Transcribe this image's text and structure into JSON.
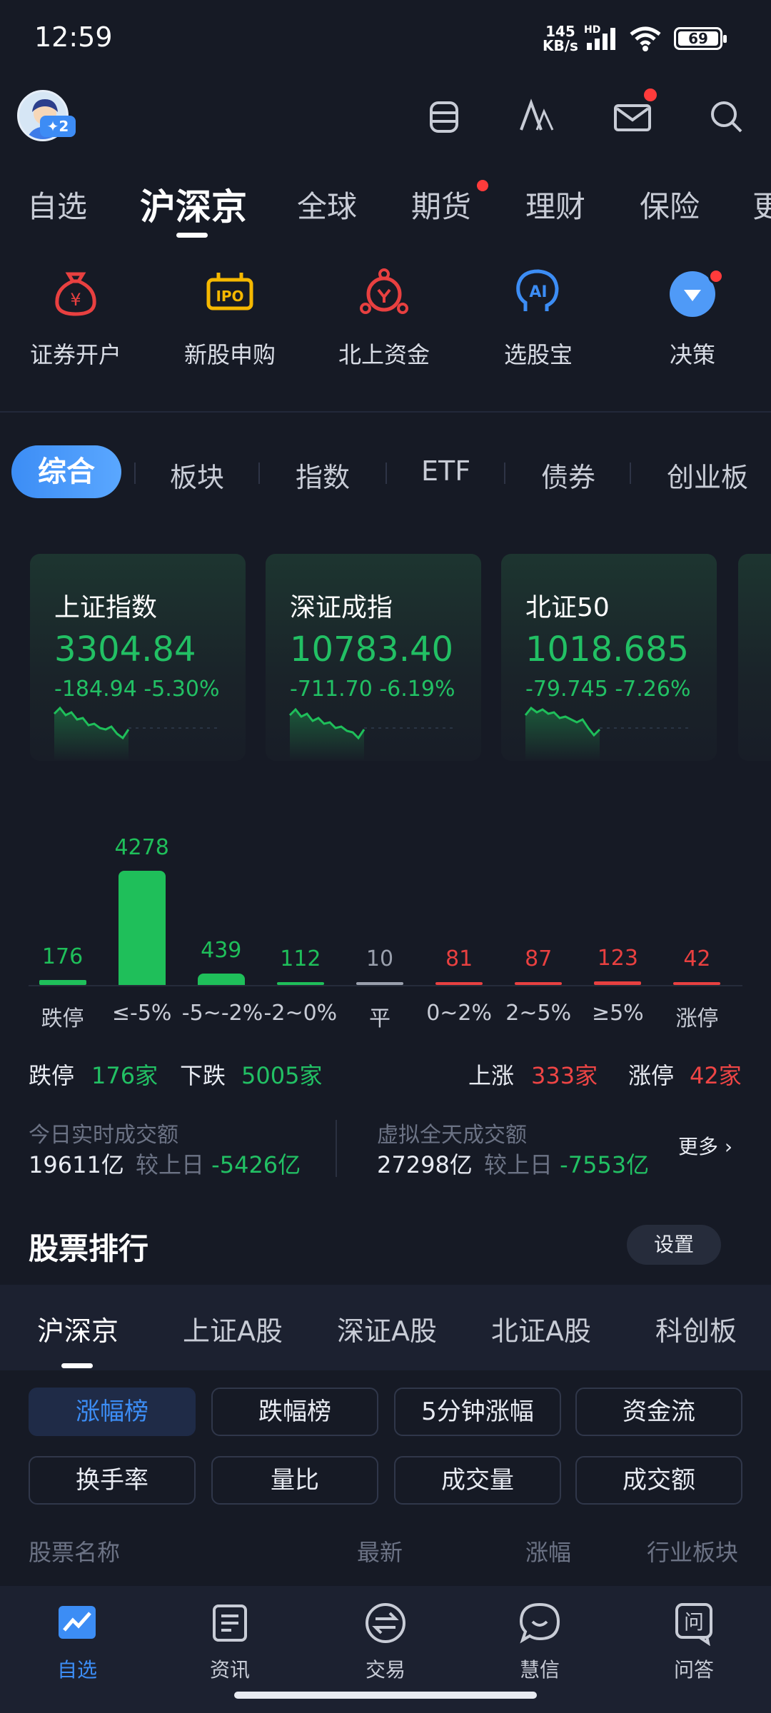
{
  "status_bar": {
    "time": "12:59",
    "net_speed_value": "145",
    "net_speed_unit": "KB/s",
    "net_type": "HD",
    "battery": "69"
  },
  "main_tabs": [
    "自选",
    "沪深京",
    "全球",
    "期货",
    "理财",
    "保险",
    "更"
  ],
  "main_tab_active": "沪深京",
  "quick_entries": [
    "证券开户",
    "新股申购",
    "北上资金",
    "选股宝",
    "决策"
  ],
  "sub_tabs": [
    "综合",
    "板块",
    "指数",
    "ETF",
    "债券",
    "创业板"
  ],
  "index_cards": [
    {
      "name": "上证指数",
      "value": "3304.84",
      "change": "-184.94",
      "pct": "-5.30%"
    },
    {
      "name": "深证成指",
      "value": "10783.40",
      "change": "-711.70",
      "pct": "-6.19%"
    },
    {
      "name": "北证50",
      "value": "1018.685",
      "change": "-79.745",
      "pct": "-7.26%"
    }
  ],
  "chart_data": {
    "type": "bar",
    "categories": [
      "跌停",
      "≤-5%",
      "-5~-2%",
      "-2~0%",
      "平",
      "0~2%",
      "2~5%",
      "≥5%",
      "涨停"
    ],
    "values": [
      176,
      4278,
      439,
      112,
      10,
      81,
      87,
      123,
      42
    ],
    "colors": [
      "#1fbf5a",
      "#1fbf5a",
      "#1fbf5a",
      "#1fbf5a",
      "#9aa0ad",
      "#e84040",
      "#e84040",
      "#e84040",
      "#e84040"
    ]
  },
  "stats": {
    "limit_down_label": "跌停",
    "limit_down_value": "176家",
    "down_label": "下跌",
    "down_value": "5005家",
    "up_label": "上涨",
    "up_value": "333家",
    "limit_up_label": "涨停",
    "limit_up_value": "42家"
  },
  "turnover": {
    "today_label": "今日实时成交额",
    "today_value": "19611亿",
    "compare_label": "较上日",
    "today_diff": "-5426亿",
    "virtual_label": "虚拟全天成交额",
    "virtual_value": "27298亿",
    "virtual_diff": "-7553亿",
    "more": "更多"
  },
  "ranking": {
    "title": "股票排行",
    "settings": "设置",
    "markets": [
      "沪深京",
      "上证A股",
      "深证A股",
      "北证A股",
      "科创板"
    ],
    "chips": [
      "涨幅榜",
      "跌幅榜",
      "5分钟涨幅",
      "资金流",
      "换手率",
      "量比",
      "成交量",
      "成交额"
    ],
    "columns": [
      "股票名称",
      "最新",
      "涨幅",
      "行业板块"
    ]
  },
  "bottom_nav": [
    "自选",
    "资讯",
    "交易",
    "慧信",
    "问答"
  ],
  "avatar_badge": "2"
}
